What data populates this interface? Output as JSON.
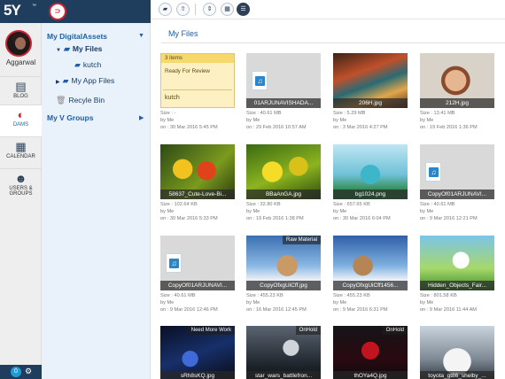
{
  "app": {
    "logo_text": "5Y",
    "logo_tm": "™",
    "user_name": "Aggarwal",
    "notification_count": "0"
  },
  "rail": [
    {
      "label": "BLOG",
      "icon": "blog-icon"
    },
    {
      "label": "DAMS",
      "icon": "dams-icon"
    },
    {
      "label": "CALENDAR",
      "icon": "calendar-icon"
    },
    {
      "label": "USERS & GROUPS",
      "icon": "users-icon"
    }
  ],
  "tree": {
    "digital_assets": "My DigitalAssets",
    "my_files": "My Files",
    "kutch": "kutch",
    "app_files": "My App Files",
    "recycle_bin": "Recyle Bin",
    "v_groups": "My V Groups"
  },
  "breadcrumb": "My Files",
  "tiles": [
    {
      "kind": "folder",
      "items": "3 items",
      "status": "Ready For Review",
      "name": "kutch",
      "size": "Size : -",
      "by": "by Me",
      "on": "on : 30 Mar 2016 5:45 PM"
    },
    {
      "kind": "doc",
      "name": "01ARJUNAVISHADA...",
      "size": "Size : 40.61 MB",
      "by": "by Me",
      "on": "on : 29 Feb 2016 10:57 AM"
    },
    {
      "kind": "img",
      "img": "boats",
      "name": "206H.jpg",
      "size": "Size : 5.29 MB",
      "by": "by Me",
      "on": "on : 3 Mar 2016 4:27 PM"
    },
    {
      "kind": "img",
      "img": "woman",
      "name": "212H.jpg",
      "size": "Size : 13.41 MB",
      "by": "by Me",
      "on": "on : 19 Feb 2016 1:36 PM"
    },
    {
      "kind": "img",
      "img": "birds",
      "name": "58637_Cute-Love-Bi...",
      "size": "Size : 102.64 KB",
      "by": "by Me",
      "on": "on : 30 Mar 2016 5:33 PM"
    },
    {
      "kind": "img",
      "img": "fruit",
      "name": "BBaAnGA.jpg",
      "size": "Size : 32.80 KB",
      "by": "by Me",
      "on": "on : 19 Feb 2016 1:38 PM"
    },
    {
      "kind": "img",
      "img": "cartoon",
      "name": "bg1024.png",
      "size": "Size : 657.65 KB",
      "by": "by Me",
      "on": "on : 30 Mar 2016 6:04 PM"
    },
    {
      "kind": "doc",
      "name": "CopyOf01ARJUNAVI...",
      "size": "Size : 40.61 MB",
      "by": "by Me",
      "on": "on : 9 Mar 2016 12:21 PM"
    },
    {
      "kind": "doc",
      "name": "CopyOf01ARJUNAVI...",
      "size": "Size : 40.61 MB",
      "by": "by Me",
      "on": "on : 9 Mar 2016 12:46 PM"
    },
    {
      "kind": "img",
      "img": "iceage",
      "tag": "Raw Material",
      "name": "CopyOfxgUiCff.jpg",
      "size": "Size : 455.23 KB",
      "by": "by Me",
      "on": "on : 16 Mar 2016 12:45 PM"
    },
    {
      "kind": "img",
      "img": "iceage2",
      "name": "CopyOfxgUiCff1456...",
      "size": "Size : 455.23 KB",
      "by": "by Me",
      "on": "on : 9 Mar 2016 6:31 PM"
    },
    {
      "kind": "img",
      "img": "unicorn",
      "name": "Hidden_Objects_Fair...",
      "size": "Size : 801.58 KB",
      "by": "by Me",
      "on": "on : 9 Mar 2016 11:44 AM"
    },
    {
      "kind": "img",
      "img": "dark1",
      "tag": "Need More Work",
      "name": "sRh8sKQ.jpg",
      "size": "",
      "by": "",
      "on": ""
    },
    {
      "kind": "img",
      "img": "starwars",
      "tag": "OnHold",
      "name": "star_wars_battlefron...",
      "size": "",
      "by": "",
      "on": ""
    },
    {
      "kind": "img",
      "img": "spider",
      "tag": "OnHold",
      "name": "thOYa4Q.jpg",
      "size": "",
      "by": "",
      "on": ""
    },
    {
      "kind": "img",
      "img": "car",
      "name": "toyota_gt86_shelby_...",
      "size": "",
      "by": "",
      "on": ""
    }
  ],
  "colors": {
    "navy": "#1f3d5c",
    "accent_blue": "#1f5fa8",
    "dams_red": "#cc2233",
    "folder_yellow": "#fdf1c4"
  }
}
